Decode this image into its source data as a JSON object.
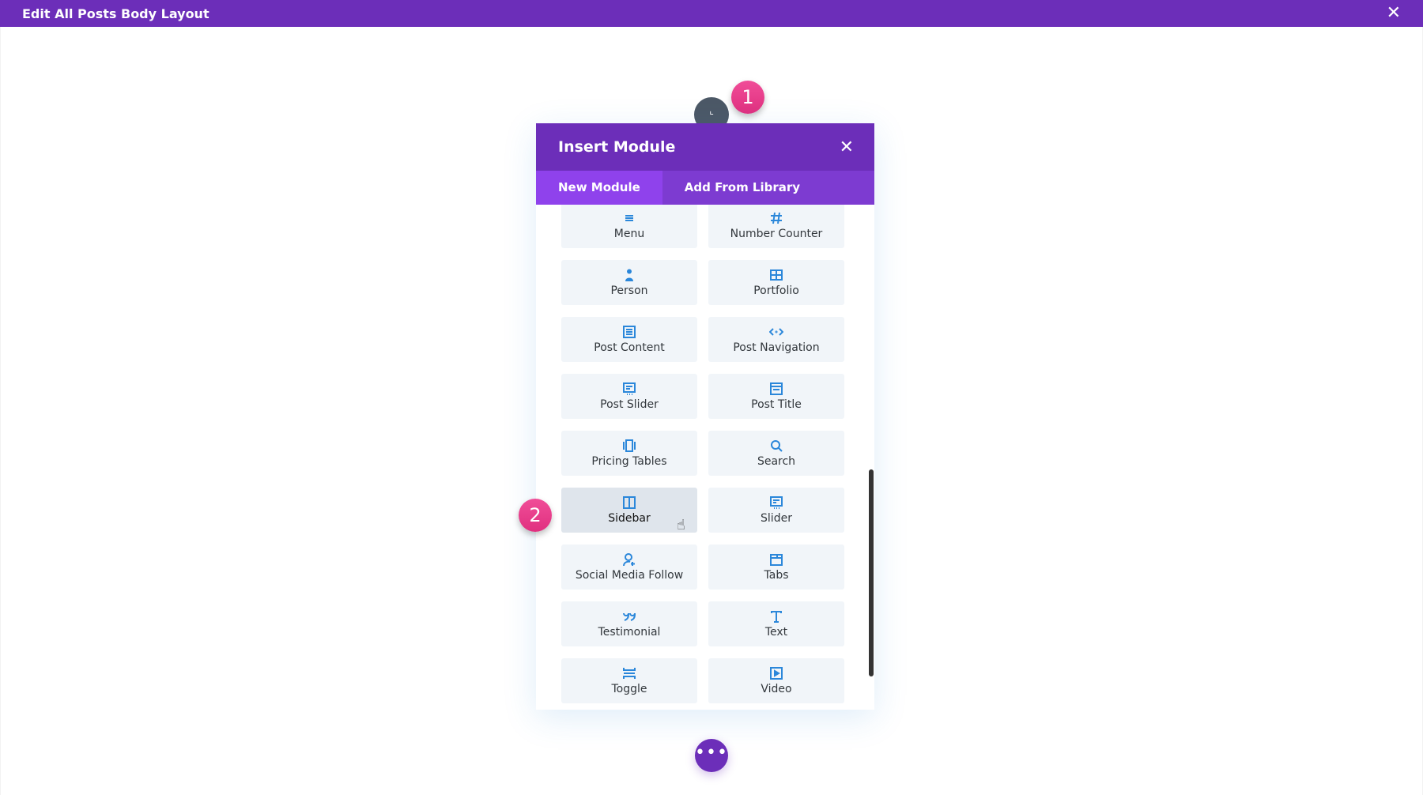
{
  "topbar": {
    "title": "Edit All Posts Body Layout",
    "close_icon": "close-icon"
  },
  "badges": {
    "one": "1",
    "two": "2"
  },
  "modal": {
    "title": "Insert Module",
    "tabs": [
      {
        "label": "New Module",
        "active": true
      },
      {
        "label": "Add From Library",
        "active": false
      }
    ],
    "modules": [
      {
        "label": "Menu",
        "icon": "menu-icon"
      },
      {
        "label": "Number Counter",
        "icon": "hash-icon"
      },
      {
        "label": "Person",
        "icon": "person-icon"
      },
      {
        "label": "Portfolio",
        "icon": "grid-icon"
      },
      {
        "label": "Post Content",
        "icon": "post-content-icon"
      },
      {
        "label": "Post Navigation",
        "icon": "code-arrows-icon"
      },
      {
        "label": "Post Slider",
        "icon": "post-slider-icon"
      },
      {
        "label": "Post Title",
        "icon": "post-title-icon"
      },
      {
        "label": "Pricing Tables",
        "icon": "pricing-tables-icon"
      },
      {
        "label": "Search",
        "icon": "search-icon"
      },
      {
        "label": "Sidebar",
        "icon": "sidebar-icon",
        "hovered": true
      },
      {
        "label": "Slider",
        "icon": "slider-icon"
      },
      {
        "label": "Social Media Follow",
        "icon": "user-plus-icon"
      },
      {
        "label": "Tabs",
        "icon": "tabs-icon"
      },
      {
        "label": "Testimonial",
        "icon": "quote-icon"
      },
      {
        "label": "Text",
        "icon": "text-icon"
      },
      {
        "label": "Toggle",
        "icon": "toggle-icon"
      },
      {
        "label": "Video",
        "icon": "video-icon"
      }
    ]
  },
  "more_button": "•••",
  "colors": {
    "primary": "#6c2eb9",
    "tab_bar": "#7d3bd1",
    "tab_active": "#8f42ec",
    "icon": "#2b87da",
    "badge": "#e83e8c"
  }
}
